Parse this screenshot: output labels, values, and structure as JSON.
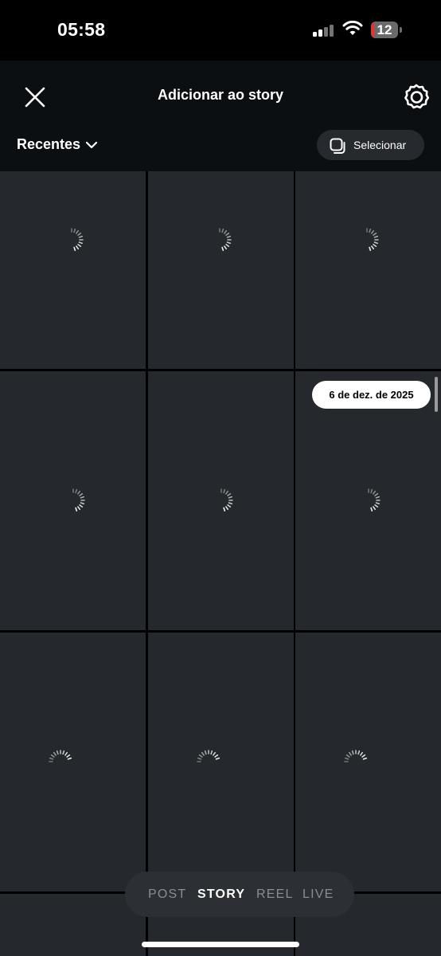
{
  "status_bar": {
    "time": "05:58",
    "battery_level": "12",
    "battery_color": "#e3342f"
  },
  "header": {
    "title": "Adicionar ao story",
    "close_icon": "close-icon",
    "settings_icon": "gear-icon"
  },
  "toolbar": {
    "album_label": "Recentes",
    "select_label": "Selecionar"
  },
  "gallery": {
    "date_label": "6 de dez. de 2025",
    "items": [
      {
        "state": "loading"
      },
      {
        "state": "loading"
      },
      {
        "state": "loading"
      },
      {
        "state": "loading"
      },
      {
        "state": "loading"
      },
      {
        "state": "loading"
      },
      {
        "state": "loading"
      },
      {
        "state": "loading"
      },
      {
        "state": "loading"
      },
      {
        "state": "loading"
      },
      {
        "state": "loading"
      },
      {
        "state": "loading"
      }
    ]
  },
  "mode_bar": {
    "modes": [
      "POST",
      "STORY",
      "REEL",
      "LIVE"
    ],
    "active": "STORY"
  },
  "colors": {
    "accent_text": "#ffffff",
    "tile_bg": "#25282c",
    "header_bg": "#0c0f12"
  }
}
